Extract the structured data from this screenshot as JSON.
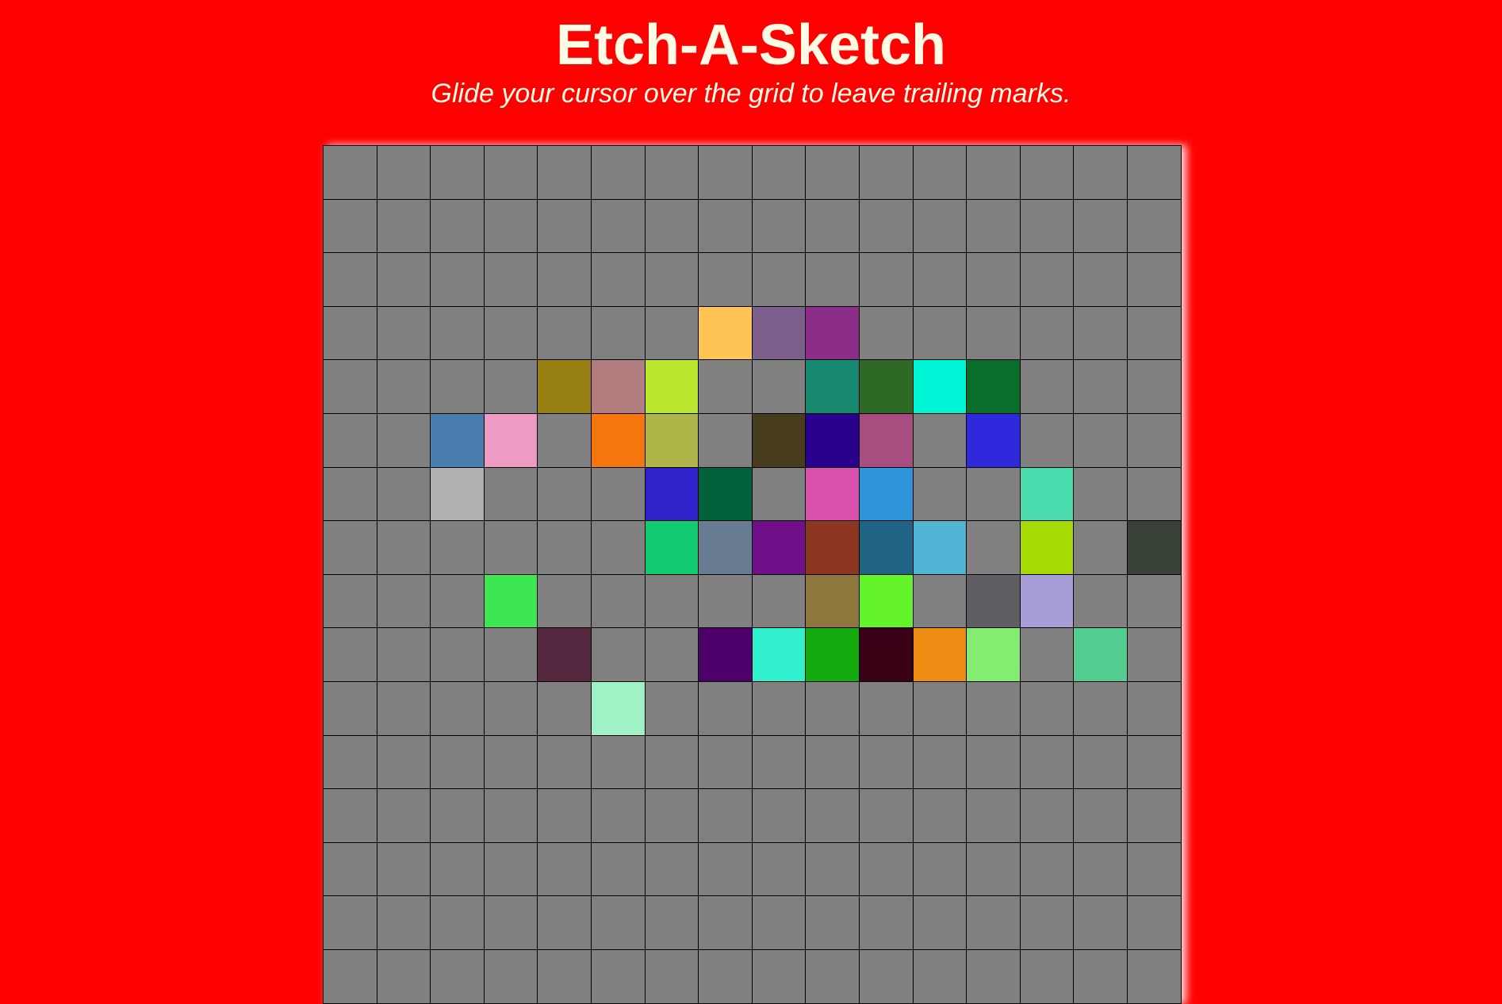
{
  "header": {
    "title": "Etch-A-Sketch",
    "subtitle": "Glide your cursor over the grid to leave trailing marks."
  },
  "colors": {
    "background": "#ff0000",
    "text": "#fffbe4",
    "cell_default": "#808080",
    "grid_line": "#000000"
  },
  "grid": {
    "rows": 16,
    "cols": 16,
    "painted": [
      {
        "row": 3,
        "col": 7,
        "color": "#ffc454"
      },
      {
        "row": 3,
        "col": 8,
        "color": "#7d5f8d"
      },
      {
        "row": 3,
        "col": 9,
        "color": "#8d2d8a"
      },
      {
        "row": 4,
        "col": 4,
        "color": "#977f12"
      },
      {
        "row": 4,
        "col": 5,
        "color": "#b17d7e"
      },
      {
        "row": 4,
        "col": 6,
        "color": "#bbe82e"
      },
      {
        "row": 4,
        "col": 9,
        "color": "#178971"
      },
      {
        "row": 4,
        "col": 10,
        "color": "#2e6925"
      },
      {
        "row": 4,
        "col": 11,
        "color": "#00f4d6"
      },
      {
        "row": 4,
        "col": 12,
        "color": "#096e2c"
      },
      {
        "row": 5,
        "col": 2,
        "color": "#4a7eaf"
      },
      {
        "row": 5,
        "col": 3,
        "color": "#f09bc4"
      },
      {
        "row": 5,
        "col": 5,
        "color": "#f5760c"
      },
      {
        "row": 5,
        "col": 6,
        "color": "#adb548"
      },
      {
        "row": 5,
        "col": 8,
        "color": "#483c1e"
      },
      {
        "row": 5,
        "col": 9,
        "color": "#28028c"
      },
      {
        "row": 5,
        "col": 10,
        "color": "#a74d7f"
      },
      {
        "row": 5,
        "col": 12,
        "color": "#2e29dc"
      },
      {
        "row": 6,
        "col": 2,
        "color": "#b0b0b0"
      },
      {
        "row": 6,
        "col": 6,
        "color": "#3022c8"
      },
      {
        "row": 6,
        "col": 7,
        "color": "#01613a"
      },
      {
        "row": 6,
        "col": 9,
        "color": "#da51ad"
      },
      {
        "row": 6,
        "col": 10,
        "color": "#2f95da"
      },
      {
        "row": 6,
        "col": 13,
        "color": "#49dbad"
      },
      {
        "row": 7,
        "col": 6,
        "color": "#12ca6f"
      },
      {
        "row": 7,
        "col": 7,
        "color": "#687c91"
      },
      {
        "row": 7,
        "col": 8,
        "color": "#710f89"
      },
      {
        "row": 7,
        "col": 9,
        "color": "#8c3622"
      },
      {
        "row": 7,
        "col": 10,
        "color": "#1f6485"
      },
      {
        "row": 7,
        "col": 11,
        "color": "#52b4d4"
      },
      {
        "row": 7,
        "col": 13,
        "color": "#a7d904"
      },
      {
        "row": 7,
        "col": 15,
        "color": "#384236"
      },
      {
        "row": 8,
        "col": 3,
        "color": "#3ee751"
      },
      {
        "row": 8,
        "col": 9,
        "color": "#8d773d"
      },
      {
        "row": 8,
        "col": 10,
        "color": "#64f32a"
      },
      {
        "row": 8,
        "col": 12,
        "color": "#605e62"
      },
      {
        "row": 8,
        "col": 13,
        "color": "#a89ed7"
      },
      {
        "row": 9,
        "col": 4,
        "color": "#55273e"
      },
      {
        "row": 9,
        "col": 7,
        "color": "#4d006a"
      },
      {
        "row": 9,
        "col": 8,
        "color": "#30f0ce"
      },
      {
        "row": 9,
        "col": 9,
        "color": "#13a90f"
      },
      {
        "row": 9,
        "col": 10,
        "color": "#3a0016"
      },
      {
        "row": 9,
        "col": 11,
        "color": "#ed8c13"
      },
      {
        "row": 9,
        "col": 12,
        "color": "#83ec71"
      },
      {
        "row": 9,
        "col": 14,
        "color": "#53cd8f"
      },
      {
        "row": 10,
        "col": 5,
        "color": "#9ef2c6"
      }
    ]
  }
}
